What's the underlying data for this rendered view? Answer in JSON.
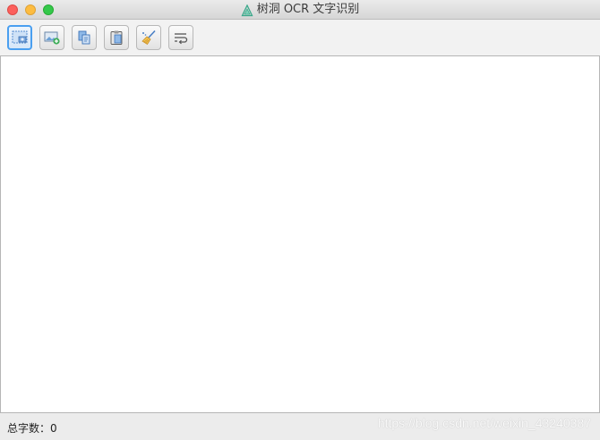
{
  "window": {
    "title": "树洞 OCR 文字识别",
    "app_icon": "tree-hole-logo-icon"
  },
  "toolbar": {
    "buttons": [
      {
        "name": "screenshot-capture-button",
        "icon": "screen-capture-icon",
        "active": true
      },
      {
        "name": "open-image-button",
        "icon": "image-add-icon",
        "active": false
      },
      {
        "name": "copy-text-button",
        "icon": "copy-icon",
        "active": false
      },
      {
        "name": "paste-button",
        "icon": "clipboard-icon",
        "active": false
      },
      {
        "name": "clear-button",
        "icon": "broom-icon",
        "active": false
      },
      {
        "name": "line-wrap-button",
        "icon": "wrap-text-icon",
        "active": false
      }
    ]
  },
  "editor": {
    "value": ""
  },
  "status": {
    "word_count_label": "总字数：0"
  },
  "watermark": {
    "text": "https://blog.csdn.net/weixin_43240387"
  },
  "colors": {
    "accent": "#4a9ff0",
    "close": "#fc605c",
    "minimize": "#fdbc40",
    "maximize": "#34c84a"
  }
}
